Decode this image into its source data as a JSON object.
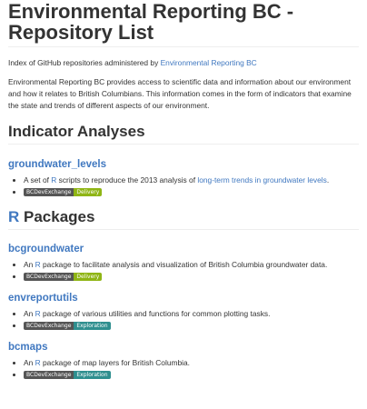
{
  "title": "Environmental Reporting BC - Repository List",
  "intro": {
    "text": "Index of GitHub repositories administered by",
    "link": "Environmental Reporting BC"
  },
  "description": "Environmental Reporting BC provides access to scientific data and information about our environment and how it relates to British Columbians. This information comes in the form of indicators that examine the state and trends of different aspects of our environment.",
  "sections": {
    "indicators": {
      "title": "Indicator Analyses",
      "items": [
        {
          "name": "groundwater_levels",
          "desc_pre": "A set of",
          "desc_link_r": "R",
          "desc_mid": "scripts to reproduce the 2013 analysis of",
          "desc_link2": "long-term trends in groundwater levels",
          "desc_post": ".",
          "badge_left": "BCDevExchange",
          "badge_right": "Delivery",
          "badge_color": "#8fb515"
        }
      ]
    },
    "packages": {
      "title_r": "R",
      "title_rest": "Packages",
      "items": [
        {
          "name": "bcgroundwater",
          "desc_pre": "An",
          "desc_link_r": "R",
          "desc_post": "package to facilitate analysis and visualization of British Columbia groundwater data.",
          "badge_left": "BCDevExchange",
          "badge_right": "Delivery",
          "badge_color": "#8fb515"
        },
        {
          "name": "envreportutils",
          "desc_pre": "An",
          "desc_link_r": "R",
          "desc_post": "package of various utilities and functions for common plotting tasks.",
          "badge_left": "BCDevExchange",
          "badge_right": "Exploration",
          "badge_color": "#2f8f8f"
        },
        {
          "name": "bcmaps",
          "desc_pre": "An",
          "desc_link_r": "R",
          "desc_post": "package of map layers for British Columbia.",
          "badge_left": "BCDevExchange",
          "badge_right": "Exploration",
          "badge_color": "#2f8f8f"
        }
      ]
    }
  },
  "colors": {
    "link": "#4078c0",
    "text": "#333333",
    "delivery": "#8fb515",
    "exploration": "#2f8f8f",
    "badge_dark": "#555555"
  }
}
